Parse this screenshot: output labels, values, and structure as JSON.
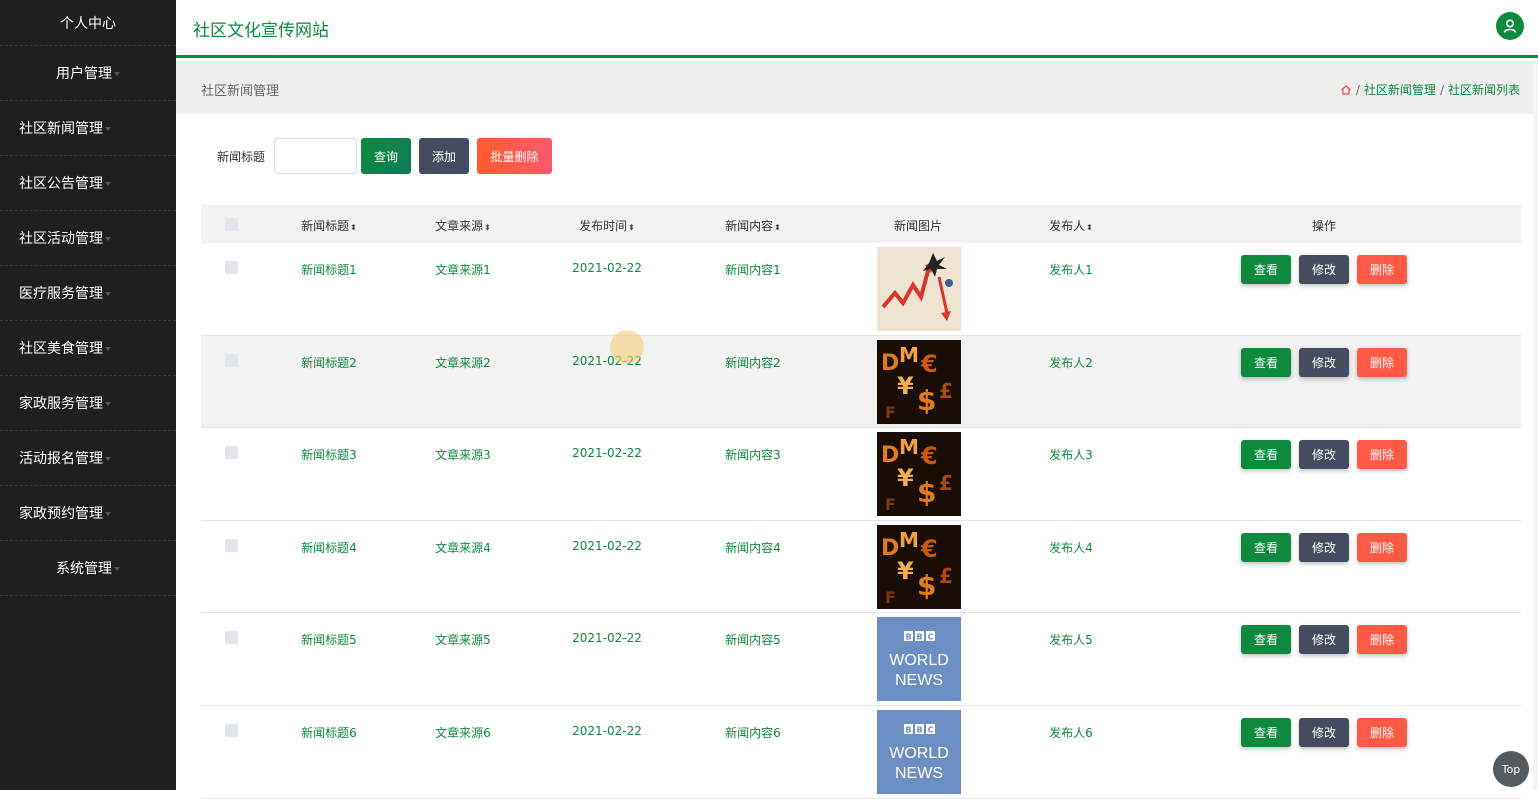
{
  "app": {
    "title": "社区文化宣传网站"
  },
  "sidebar": {
    "items": [
      {
        "label": "个人中心",
        "centered": true,
        "caret": false
      },
      {
        "label": "用户管理",
        "centered": true,
        "caret": true
      },
      {
        "label": "社区新闻管理",
        "centered": false,
        "caret": true
      },
      {
        "label": "社区公告管理",
        "centered": false,
        "caret": true
      },
      {
        "label": "社区活动管理",
        "centered": false,
        "caret": true
      },
      {
        "label": "医疗服务管理",
        "centered": false,
        "caret": true
      },
      {
        "label": "社区美食管理",
        "centered": false,
        "caret": true
      },
      {
        "label": "家政服务管理",
        "centered": false,
        "caret": true
      },
      {
        "label": "活动报名管理",
        "centered": false,
        "caret": true
      },
      {
        "label": "家政预约管理",
        "centered": false,
        "caret": true
      },
      {
        "label": "系统管理",
        "centered": true,
        "caret": true
      }
    ]
  },
  "page": {
    "title": "社区新闻管理",
    "breadcrumb": [
      "社区新闻管理",
      "社区新闻列表"
    ]
  },
  "search": {
    "label": "新闻标题",
    "value": "",
    "query_label": "查询",
    "add_label": "添加",
    "batch_delete_label": "批量删除"
  },
  "table": {
    "headers": {
      "title": "新闻标题",
      "source": "文章来源",
      "time": "发布时间",
      "content": "新闻内容",
      "image": "新闻图片",
      "publisher": "发布人",
      "actions": "操作"
    },
    "actions": {
      "view": "查看",
      "edit": "修改",
      "delete": "删除"
    },
    "rows": [
      {
        "title": "新闻标题1",
        "source": "文章来源1",
        "time": "2021-02-22",
        "content": "新闻内容1",
        "publisher": "发布人1",
        "image": "finance-chart"
      },
      {
        "title": "新闻标题2",
        "source": "文章来源2",
        "time": "2021-02-22",
        "content": "新闻内容2",
        "publisher": "发布人2",
        "image": "currency-symbols"
      },
      {
        "title": "新闻标题3",
        "source": "文章来源3",
        "time": "2021-02-22",
        "content": "新闻内容3",
        "publisher": "发布人3",
        "image": "currency-symbols"
      },
      {
        "title": "新闻标题4",
        "source": "文章来源4",
        "time": "2021-02-22",
        "content": "新闻内容4",
        "publisher": "发布人4",
        "image": "currency-symbols"
      },
      {
        "title": "新闻标题5",
        "source": "文章来源5",
        "time": "2021-02-22",
        "content": "新闻内容5",
        "publisher": "发布人5",
        "image": "bbc-world-news"
      },
      {
        "title": "新闻标题6",
        "source": "文章来源6",
        "time": "2021-02-22",
        "content": "新闻内容6",
        "publisher": "发布人6",
        "image": "bbc-world-news"
      }
    ]
  },
  "bbc_logo": {
    "line1": "BBC",
    "line2": "WORLD",
    "line3": "NEWS"
  },
  "back_to_top": "Top",
  "colors": {
    "primary": "#0e8a3e",
    "sidebar_bg": "#1f1f1f",
    "delete": "#ff5a45",
    "dark_button": "#454c5e"
  }
}
